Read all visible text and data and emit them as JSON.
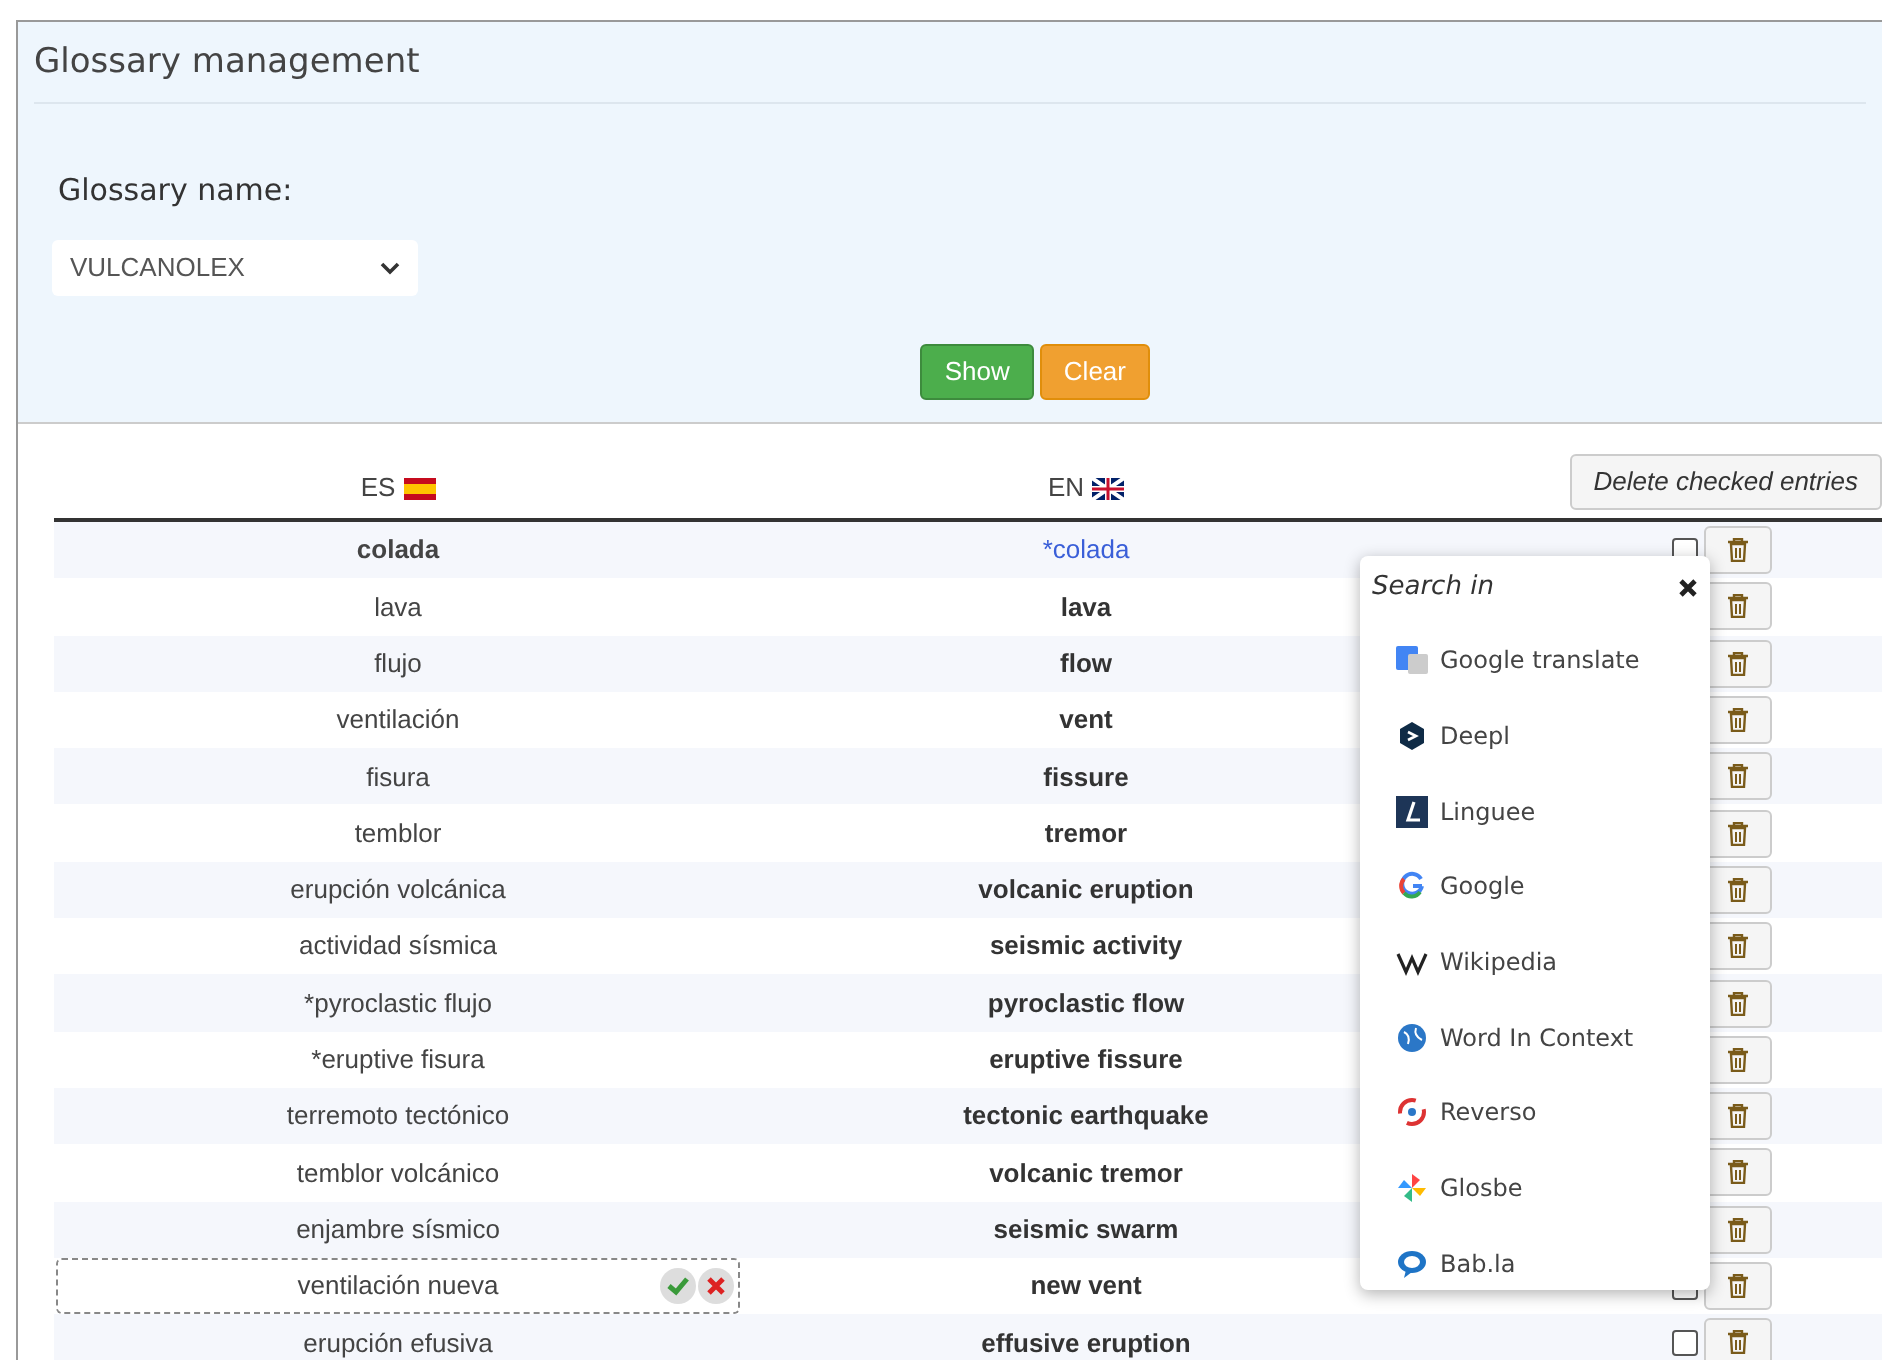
{
  "panel": {
    "title": "Glossary management"
  },
  "form": {
    "label": "Glossary name:",
    "select_value": "VULCANOLEX",
    "buttons": [
      {
        "label": "Show",
        "kind": "primary"
      },
      {
        "label": "Clear",
        "kind": "warning"
      }
    ]
  },
  "table": {
    "columns": [
      "ES",
      "EN"
    ],
    "delete_button": "Delete checked entries",
    "rows": [
      {
        "es": "colada",
        "en": "*colada",
        "kind": "current",
        "checked": false
      },
      {
        "es": "lava",
        "en": "lava",
        "kind": "plain"
      },
      {
        "es": "flujo",
        "en": "flow",
        "kind": "plain"
      },
      {
        "es": "ventilación",
        "en": "vent",
        "kind": "plain"
      },
      {
        "es": "fisura",
        "en": "fissure",
        "kind": "plain"
      },
      {
        "es": "temblor",
        "en": "tremor",
        "kind": "plain"
      },
      {
        "es": "erupción volcánica",
        "en": "volcanic eruption",
        "kind": "plain"
      },
      {
        "es": "actividad sísmica",
        "en": "seismic activity",
        "kind": "plain"
      },
      {
        "es": "*pyroclastic flujo",
        "en": "pyroclastic flow",
        "kind": "plain"
      },
      {
        "es": "*eruptive fisura",
        "en": "eruptive fissure",
        "kind": "plain"
      },
      {
        "es": "terremoto tectónico",
        "en": "tectonic earthquake",
        "kind": "plain"
      },
      {
        "es": "temblor volcánico",
        "en": "volcanic tremor",
        "kind": "plain"
      },
      {
        "es": "enjambre sísmico",
        "en": "seismic swarm",
        "kind": "plain"
      },
      {
        "es": "ventilación nueva",
        "en": "new vent",
        "kind": "editing",
        "checked": false
      },
      {
        "es": "erupción efusiva",
        "en": "effusive eruption",
        "kind": "plain",
        "checked": false
      }
    ]
  },
  "popup": {
    "title": "Search in",
    "items": [
      {
        "label": "Google translate",
        "kind": "gtranslate"
      },
      {
        "label": "Deepl",
        "kind": "deepl"
      },
      {
        "label": "Linguee",
        "kind": "linguee"
      },
      {
        "label": "Google",
        "kind": "google"
      },
      {
        "label": "Wikipedia",
        "kind": "wikipedia"
      },
      {
        "label": "Word In Context",
        "kind": "wic"
      },
      {
        "label": "Reverso",
        "kind": "reverso"
      },
      {
        "label": "Glosbe",
        "kind": "glosbe"
      },
      {
        "label": "Bab.la",
        "kind": "babla"
      }
    ]
  }
}
